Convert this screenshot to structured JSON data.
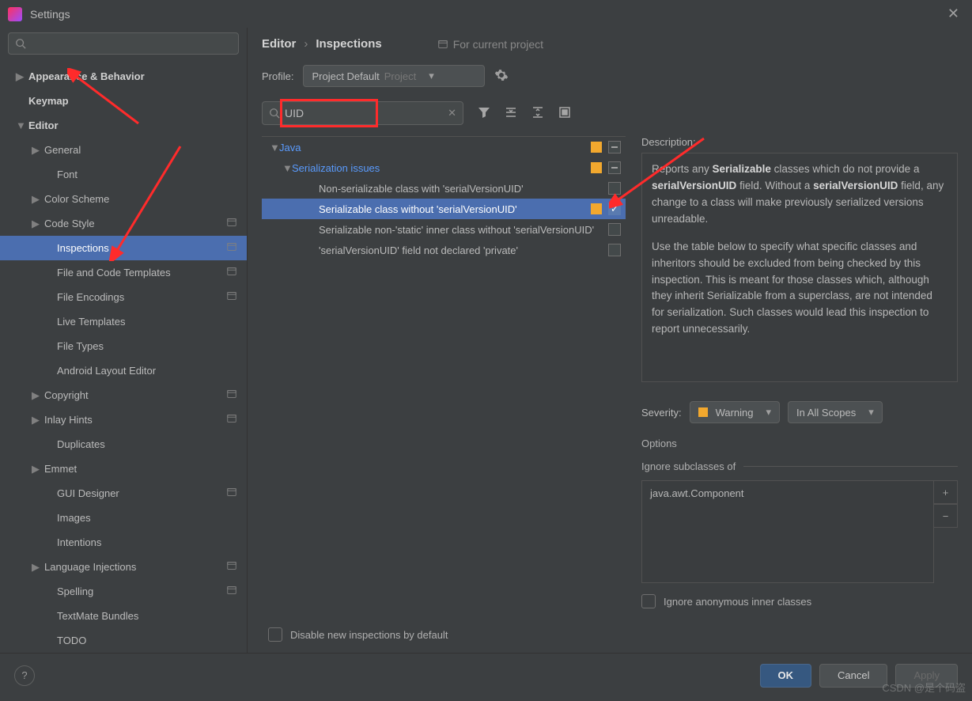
{
  "window": {
    "title": "Settings"
  },
  "sidebar_search": {
    "placeholder": ""
  },
  "sidebar": {
    "items": [
      {
        "label": "Appearance & Behavior",
        "bold": true,
        "chev": "▶",
        "indent": 0
      },
      {
        "label": "Keymap",
        "bold": true,
        "chev": "",
        "indent": 0
      },
      {
        "label": "Editor",
        "bold": true,
        "chev": "▼",
        "indent": 0
      },
      {
        "label": "General",
        "chev": "▶",
        "indent": 1
      },
      {
        "label": "Font",
        "chev": "",
        "indent": 2
      },
      {
        "label": "Color Scheme",
        "chev": "▶",
        "indent": 1
      },
      {
        "label": "Code Style",
        "chev": "▶",
        "indent": 1,
        "proj": true
      },
      {
        "label": "Inspections",
        "chev": "",
        "indent": 2,
        "proj": true,
        "selected": true
      },
      {
        "label": "File and Code Templates",
        "chev": "",
        "indent": 2,
        "proj": true
      },
      {
        "label": "File Encodings",
        "chev": "",
        "indent": 2,
        "proj": true
      },
      {
        "label": "Live Templates",
        "chev": "",
        "indent": 2
      },
      {
        "label": "File Types",
        "chev": "",
        "indent": 2
      },
      {
        "label": "Android Layout Editor",
        "chev": "",
        "indent": 2
      },
      {
        "label": "Copyright",
        "chev": "▶",
        "indent": 1,
        "proj": true
      },
      {
        "label": "Inlay Hints",
        "chev": "▶",
        "indent": 1,
        "proj": true
      },
      {
        "label": "Duplicates",
        "chev": "",
        "indent": 2
      },
      {
        "label": "Emmet",
        "chev": "▶",
        "indent": 1
      },
      {
        "label": "GUI Designer",
        "chev": "",
        "indent": 2,
        "proj": true
      },
      {
        "label": "Images",
        "chev": "",
        "indent": 2
      },
      {
        "label": "Intentions",
        "chev": "",
        "indent": 2
      },
      {
        "label": "Language Injections",
        "chev": "▶",
        "indent": 1,
        "proj": true
      },
      {
        "label": "Spelling",
        "chev": "",
        "indent": 2,
        "proj": true
      },
      {
        "label": "TextMate Bundles",
        "chev": "",
        "indent": 2
      },
      {
        "label": "TODO",
        "chev": "",
        "indent": 2
      }
    ]
  },
  "breadcrumb": {
    "root": "Editor",
    "leaf": "Inspections",
    "for_project": "For current project"
  },
  "profile": {
    "label": "Profile:",
    "value": "Project Default",
    "scope": "Project"
  },
  "inspection_search": {
    "value": "UID"
  },
  "inspection_tree": [
    {
      "label": "Java",
      "cat": true,
      "level": 0,
      "chev": "▼",
      "sq": true,
      "dash": true
    },
    {
      "label": "Serialization issues",
      "cat": true,
      "level": 1,
      "chev": "▼",
      "sq": true,
      "dash": true
    },
    {
      "label": "Non-serializable class with 'serialVersionUID'",
      "level": 2,
      "checked": false
    },
    {
      "label": "Serializable class without 'serialVersionUID'",
      "level": 2,
      "selected": true,
      "sq": true,
      "checked": true
    },
    {
      "label": "Serializable non-'static' inner class without 'serialVersionUID'",
      "level": 2,
      "checked": false
    },
    {
      "label": "'serialVersionUID' field not declared 'private'",
      "level": 2,
      "checked": false
    }
  ],
  "description": {
    "title": "Description:",
    "p1a": "Reports any ",
    "p1b": "Serializable",
    "p1c": " classes which do not provide a ",
    "p1d": "serialVersionUID",
    "p1e": " field. Without a ",
    "p1f": "serialVersionUID",
    "p1g": " field, any change to a class will make previously serialized versions unreadable.",
    "p2": "Use the table below to specify what specific classes and inheritors should be excluded from being checked by this inspection. This is meant for those classes which, although they inherit Serializable from a superclass, are not intended for serialization. Such classes would lead this inspection to report unnecessarily."
  },
  "severity": {
    "label": "Severity:",
    "value": "Warning",
    "scope": "In All Scopes"
  },
  "options": {
    "label": "Options",
    "ignore_label": "Ignore subclasses of",
    "ignore_value": "java.awt.Component",
    "anon_label": "Ignore anonymous inner classes"
  },
  "disable_row": "Disable new inspections by default",
  "footer": {
    "ok": "OK",
    "cancel": "Cancel",
    "apply": "Apply"
  },
  "watermark": "CSDN @是个码盗"
}
